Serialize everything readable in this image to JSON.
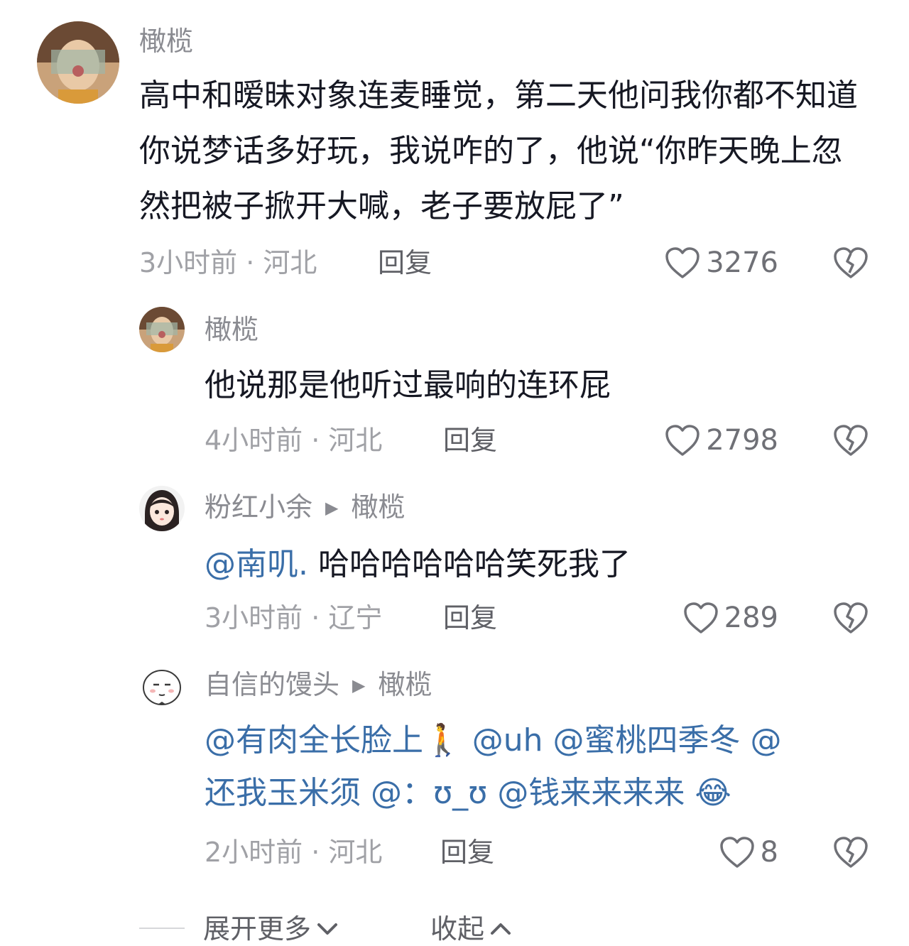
{
  "comments": [
    {
      "username": "橄榄",
      "text": "高中和暧昧对象连麦睡觉，第二天他问我你都不知道你说梦话多好玩，我说咋的了，他说“你昨天晚上忽然把被子掀开大喊，老子要放屁了”",
      "time_location": "3小时前 · 河北",
      "reply_label": "回复",
      "likes": "3276"
    },
    {
      "username": "橄榄",
      "text": "他说那是他听过最响的连环屁",
      "time_location": "4小时前 · 河北",
      "reply_label": "回复",
      "likes": "2798"
    },
    {
      "username": "粉红小余",
      "reply_to": "橄榄",
      "mention": "@南叽.",
      "text": " 哈哈哈哈哈哈笑死我了",
      "time_location": "3小时前 · 辽宁",
      "reply_label": "回复",
      "likes": "289"
    },
    {
      "username": "自信的馒头",
      "reply_to": "橄榄",
      "line1": "@有肉全长脸上🚶 @uh @蜜桃四季冬 @",
      "line2": "还我玉米须 @：ʊ_ʊ @钱来来来来 😂",
      "time_location": "2小时前 · 河北",
      "reply_label": "回复",
      "likes": "8"
    }
  ],
  "footer": {
    "expand_more": "展开更多",
    "collapse": "收起"
  },
  "colors": {
    "mention": "#3a6ea8",
    "meta": "#a0a1a6",
    "text": "#161823"
  },
  "icons": [
    "heart-outline-icon",
    "broken-heart-icon",
    "chevron-down-icon",
    "chevron-up-icon",
    "play-triangle-icon"
  ]
}
